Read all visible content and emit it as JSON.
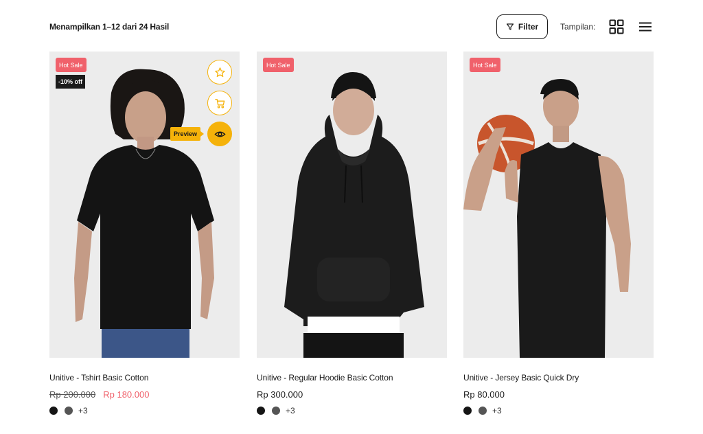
{
  "toolbar": {
    "result_text": "Menampilkan 1–12 dari 24 Hasil",
    "filter_label": "Filter",
    "view_label": "Tampilan:",
    "icons": [
      "filter-icon",
      "grid-view-icon",
      "list-view-icon"
    ]
  },
  "colors": {
    "accent": "#f5b20a",
    "sale_badge": "#f0616b",
    "sale_price": "#f0616b",
    "discount_badge": "#1b1b1b",
    "swatch_black": "#151515",
    "swatch_gray": "#555555"
  },
  "products": [
    {
      "badge": "Hot Sale",
      "discount": "-10% off",
      "name": "Unitive - Tshirt Basic Cotton",
      "price_old": "Rp 200.000",
      "price_new": "Rp 180.000",
      "more_colors": "+3",
      "actions": [
        "star-icon",
        "cart-icon",
        "eye-icon"
      ],
      "tooltip": "Preview"
    },
    {
      "badge": "Hot Sale",
      "name": "Unitive - Regular Hoodie Basic Cotton",
      "price": "Rp 300.000",
      "more_colors": "+3"
    },
    {
      "badge": "Hot Sale",
      "name": "Unitive - Jersey Basic Quick Dry",
      "price": "Rp 80.000",
      "more_colors": "+3"
    }
  ]
}
